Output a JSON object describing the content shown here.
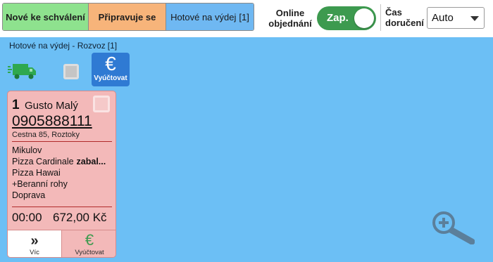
{
  "tabs": [
    {
      "label": "Nové ke schválení",
      "color": "#8ee28e"
    },
    {
      "label": "Připravuje se",
      "color": "#f7b47a"
    },
    {
      "label": "Hotové na výdej",
      "count": "[1]",
      "color": "#6fb8f2"
    }
  ],
  "online": {
    "label_line1": "Online",
    "label_line2": "objednání",
    "toggle_label": "Zap.",
    "toggle_on": true,
    "toggle_color": "#3d9a4f"
  },
  "delivery_time": {
    "label_line1": "Čas",
    "label_line2": "doručení",
    "selected": "Auto"
  },
  "panel": {
    "title": "Hotové na výdej - Rozvoz",
    "count": "[1]",
    "background": "#6cbff5",
    "bill_button_symbol": "€",
    "bill_button_label": "Vyúčtovat"
  },
  "order": {
    "number": "1",
    "name": "Gusto Malý",
    "phone": "0905888111",
    "address": "Cestna 85, Roztoky",
    "items": [
      {
        "text": "Mikulov",
        "tag": ""
      },
      {
        "text": "Pizza Cardinale",
        "tag": "zabal..."
      },
      {
        "text": "Pizza Hawai",
        "tag": ""
      },
      {
        "text": "+Beranní rohy",
        "tag": ""
      },
      {
        "text": "Doprava",
        "tag": ""
      }
    ],
    "time": "00:00",
    "price": "672,00 Kč",
    "more_symbol": "»",
    "more_label": "Víc",
    "bill_symbol": "€",
    "bill_label": "Vyúčtovat",
    "card_color": "#f3b9b9"
  },
  "icons": {
    "truck": "truck-icon",
    "zoom": "zoom-in-icon",
    "checkbox": "checkbox-icon"
  }
}
